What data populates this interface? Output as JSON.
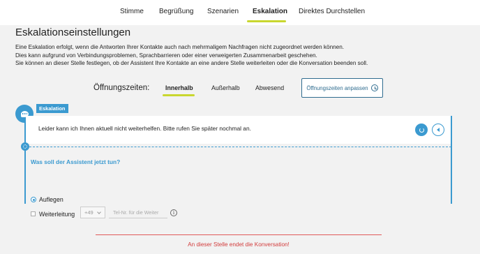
{
  "nav": {
    "tabs": [
      {
        "label": "Stimme"
      },
      {
        "label": "Begrüßung"
      },
      {
        "label": "Szenarien"
      },
      {
        "label": "Eskalation"
      },
      {
        "label": "Direktes Durchstellen"
      }
    ],
    "active": "Eskalation"
  },
  "page": {
    "title": "Eskalationseinstellungen",
    "description": [
      "Eine Eskalation erfolgt, wenn die Antworten Ihrer Kontakte auch nach mehrmaligem Nachfragen nicht zugeordnet werden können.",
      "Dies kann aufgrund von Verbindungsproblemen, Sprachbarrieren oder einer verweigerten Zusammenarbeit geschehen.",
      "Sie können an dieser Stelle festlegen, ob der Assistent Ihre Kontakte an eine andere Stelle weiterleiten oder die Konversation beenden soll."
    ]
  },
  "opening_hours": {
    "label": "Öffnungszeiten:",
    "tabs": [
      {
        "label": "Innerhalb"
      },
      {
        "label": "Außerhalb"
      },
      {
        "label": "Abwesend"
      }
    ],
    "active": "Innerhalb",
    "adjust_button": "Öffnungszeiten anpassen"
  },
  "escalation": {
    "badge": "Eskalation",
    "message": "Leider kann ich Ihnen aktuell nicht weiterhelfen. Bitte rufen Sie später nochmal an.",
    "question": "Was soll der Assistent jetzt tun?",
    "options": [
      {
        "label": "Auflegen",
        "selected": true
      },
      {
        "label": "Weiterleitung",
        "selected": false
      }
    ],
    "forward": {
      "prefix": "+49",
      "phone_placeholder": "Tel-Nr. für die Weiter"
    },
    "info_symbol": "i",
    "end_notice": "An dieser Stelle endet die Konversation!"
  },
  "colors": {
    "accent_blue": "#3b9ad0",
    "active_underline": "#c9d72f",
    "end_red": "#d23c3c"
  }
}
